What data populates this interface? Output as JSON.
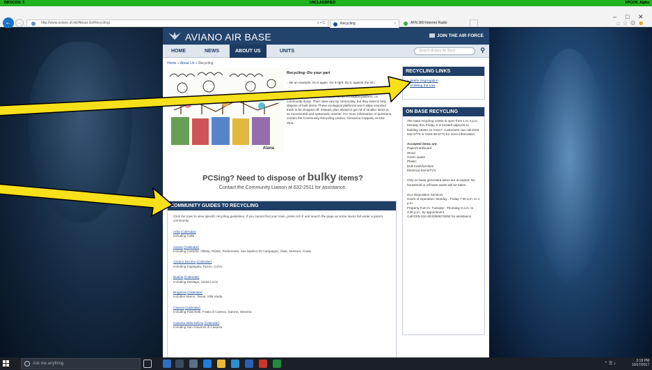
{
  "classification": {
    "left": "INFOCON: 3",
    "center": "UNCLASSIFIED",
    "right": "FPCON: Alpha"
  },
  "browser": {
    "url": "http://www.aviano.af.mil/About-Us/Recycling/",
    "address_actions": "⌕ ▾ C",
    "tabs": [
      {
        "label": "Recycling",
        "active": true
      },
      {
        "label": "AFN 360 Internet Radio",
        "active": false
      }
    ],
    "window_controls": {
      "minimize": "–",
      "maximize": "□",
      "close": "✕"
    }
  },
  "site": {
    "title": "AVIANO AIR BASE",
    "join": "JOIN THE AIR FORCE",
    "nav": [
      "HOME",
      "NEWS",
      "ABOUT US",
      "UNITS"
    ],
    "active_nav": "ABOUT US",
    "search_placeholder": "Search Aviano Air Base",
    "breadcrumb": {
      "home": "Home",
      "about": "About Us",
      "current": "Recycling",
      "sep": " » "
    },
    "intro": {
      "title": "Recycling--Do your part",
      "paragraph1": "...Be an example. Do it again. Do it right. Do it, against the bin.",
      "paragraph2": "Every community in the local area has an ecological platform, i.e. community dump. Their rules vary by community, but they exist to help dispose of bulk items. These ecological platforms won't allow unsorted trash to be dropped off. Instead, plan ahead to get rid of smaller items in an incremental and systematic manner. For more information or questions, contact the Community Recycling Liaison, Giovanna Coppola, at 632-2511."
    },
    "drawing_caption": "Alana",
    "pcs": {
      "lead": "PCSing? Need to dispose of ",
      "bulky": "bulky",
      "tail": " items?"
    },
    "contact": "Contact the Community Liaison at 632-2511 for assistance."
  },
  "guides": {
    "heading": "COMMUNITY GUIDES TO RECYCLING",
    "intro": "Click the town to view specific recycling guidelines. If you cannot find your town, press ctrl+F and search the page as some towns fall under a parent community.",
    "calendar_label": "(Calendar)",
    "towns": [
      {
        "name": "Arba",
        "note": "Including Colle"
      },
      {
        "name": "Aviano",
        "note": "Including Castello, Villotta, Piante, Pedemonte, San Martino Di Campagna, Glais, Marsure, Costa"
      },
      {
        "name": "Azzano Decimo",
        "note": "Including Fagnigola, Tiezzo, Corvo"
      },
      {
        "name": "Budoia",
        "note": "Including Dardago, Santa Lucia"
      },
      {
        "name": "Brugnera",
        "note": "Includes Maron, Tamai, Villa Varda"
      },
      {
        "name": "Caneva",
        "note": "Including Fiaschetti, Fratta di Caneva, Sarone, Stevena"
      },
      {
        "name": "Casarsa della Delizia",
        "note": "Including San Giovanni di Casarsa"
      }
    ]
  },
  "sidebar": {
    "links_heading": "RECYCLING LINKS",
    "links": [
      "Waste Segregation",
      "Violating the Law"
    ],
    "onbase_heading": "ON BASE RECYCLING",
    "hours": "The base recycling center is open from 1 to 4 p.m. Monday thru Friday. It is located adjacent to building 18462 on Area F. Customers can call DSN 632-5770 or 0434-30-5770 for more information.",
    "accepted_label": "Accepted items are:",
    "accepted": [
      "Paper/Cardboard",
      "Wood",
      "Green waste",
      "Plastic",
      "Bulk trash/furniture",
      "Electrical Items/TV's"
    ],
    "onbase_note": "Only on-base generated items are accepted. No household or off-base waste will be taken.",
    "dla": [
      "DLA Disposition Services",
      "Hours of Operation: Monday - Friday 7:30 a.m. to 4 p.m.",
      "Property Turn In: Tuesday - Thursday 8 a.m. to 3:30 p.m., by appointment",
      "Call DSN 632-8233/8087/5092 for assistance."
    ]
  },
  "taskbar": {
    "search_placeholder": "Ask me anything",
    "time": "2:18 PM",
    "date": "10/17/2017"
  },
  "colors": {
    "classification": "#1fb31f",
    "site_header": "#22436b",
    "box_header": "#1f3f66",
    "arrow_fill": "#f5e01a",
    "link": "#1b4e9a"
  }
}
